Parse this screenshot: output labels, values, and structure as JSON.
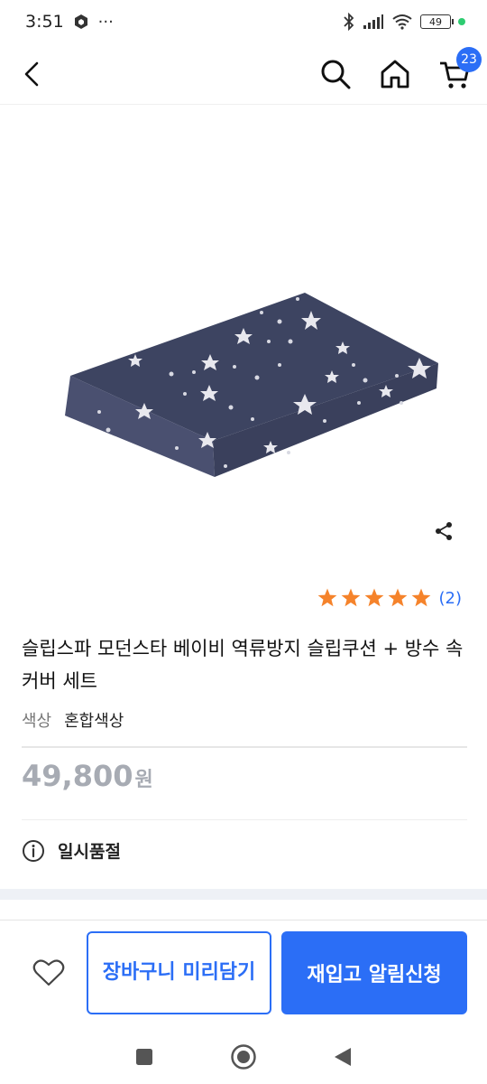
{
  "status_bar": {
    "time": "3:51",
    "extra": "···",
    "battery": "49"
  },
  "header": {
    "back_icon": "chevron-left-icon",
    "search_icon": "search-icon",
    "home_icon": "home-icon",
    "cart_icon": "cart-icon",
    "cart_count": "23"
  },
  "product": {
    "image_desc_icon": "pillow-image",
    "rating_stars": 5,
    "review_count": "(2)",
    "title": "슬립스파 모던스타 베이비 역류방지 슬립쿠션 + 방수 속커버 세트",
    "option_label": "색상",
    "option_value": "혼합색상",
    "price": "49,800",
    "price_unit": "원",
    "status": "일시품절"
  },
  "actions": {
    "wishlist_icon": "heart-icon",
    "cart_button": "장바구니 미리담기",
    "notify_button": "재입고 알림신청"
  },
  "colors": {
    "accent": "#2b6ef6",
    "star": "#f5832b",
    "price_gray": "#a7abb3"
  }
}
